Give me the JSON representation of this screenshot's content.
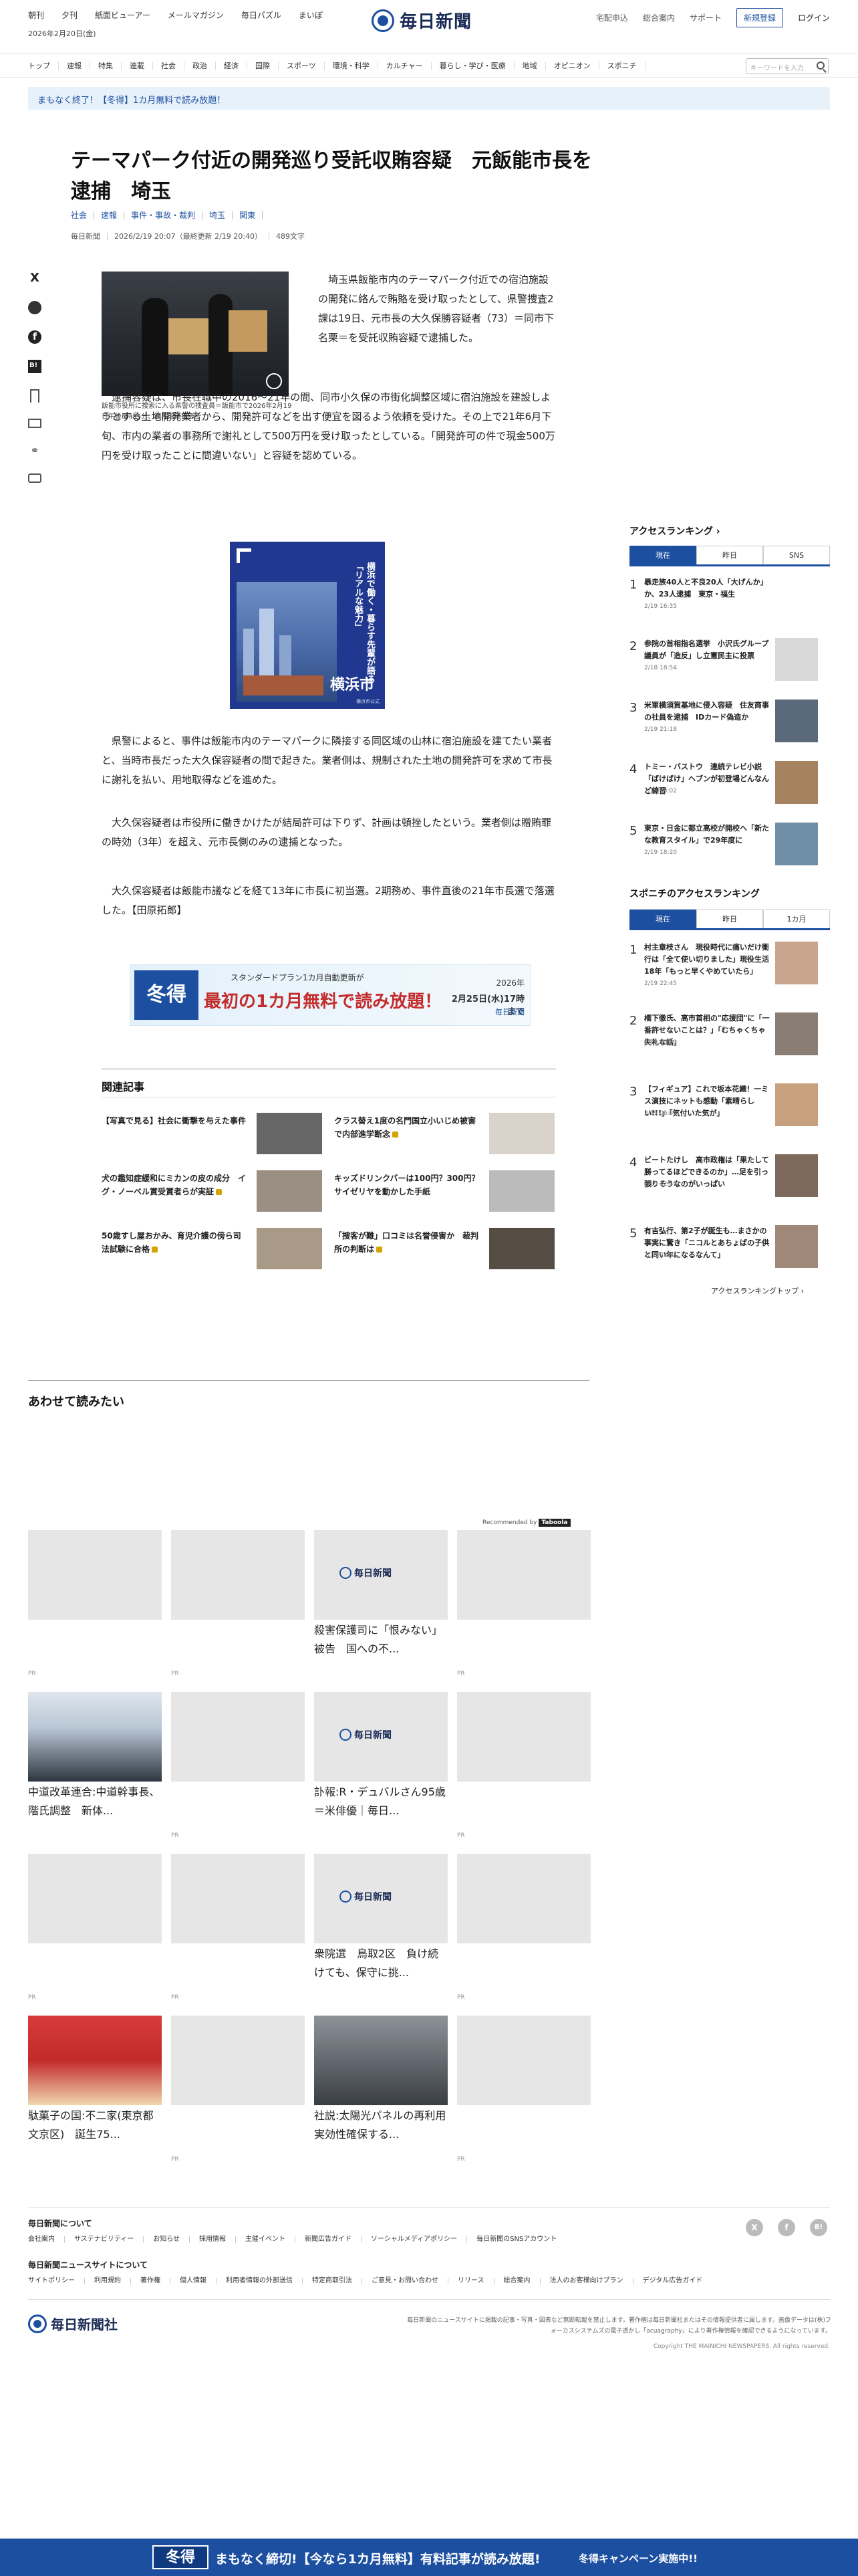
{
  "header": {
    "util_links": [
      "朝刊",
      "夕刊",
      "紙面ビューアー",
      "メールマガジン",
      "毎日パズル",
      "まいぽ"
    ],
    "date": "2026年2月20日(金)",
    "logo_text": "毎日新聞",
    "right_links": [
      "宅配申込",
      "総合案内",
      "サポート"
    ],
    "register_label": "新規登録",
    "login_label": "ログイン"
  },
  "nav": {
    "items": [
      "トップ",
      "速報",
      "特集",
      "連載",
      "社会",
      "政治",
      "経済",
      "国際",
      "スポーツ",
      "環境・科学",
      "カルチャー",
      "暮らし・学び・医療",
      "地域",
      "オピニオン",
      "スポニチ"
    ],
    "search_placeholder": "キーワードを入力"
  },
  "promo": {
    "text": "まもなく終了！【冬得】1カ月無料で読み放題！"
  },
  "article": {
    "title": "テーマパーク付近の開発巡り受託収賄容疑　元飯能市長を逮捕　埼玉",
    "tags": [
      "社会",
      "速報",
      "事件・事故・裁判",
      "埼玉",
      "関東"
    ],
    "meta": [
      "毎日新聞",
      "2026/2/19 20:07（最終更新 2/19 20:40）",
      "489文字"
    ],
    "photo_caption": "飯能市役所に捜索に入る県警の捜査員＝飯能市で2026年2月19日午後6時55分、高木昭午撮影",
    "p1": "埼玉県飯能市内のテーマパーク付近での宿泊施設の開発に絡んで賄賂を受け取ったとして、県警捜査2課は19日、元市長の大久保勝容疑者（73）＝同市下名栗＝を受託収賄容疑で逮捕した。",
    "p2": "逮捕容疑は、市長在職中の2016〜21年の間、同市小久保の市街化調整区域に宿泊施設を建設しようとする土地開発業者から、開発許可などを出す便宜を図るよう依頼を受けた。その上で21年6月下旬、市内の業者の事務所で謝礼として500万円を受け取ったとしている。「開発許可の件で現金500万円を受け取ったことに間違いない」と容疑を認めている。",
    "p3": "県警によると、事件は飯能市内のテーマパークに隣接する同区域の山林に宿泊施設を建てたい業者と、当時市長だった大久保容疑者の間で起きた。業者側は、規制された土地の開発許可を求めて市長に謝礼を払い、用地取得などを進めた。",
    "p4": "大久保容疑者は市役所に働きかけたが結局許可は下りず、計画は頓挫したという。業者側は贈賄罪の時効（3年）を超え、元市長側のみの逮捕となった。",
    "p5": "大久保容疑者は飯能市議などを経て13年に市長に初当選。2期務め、事件直後の21年市長選で落選した。【田原拓郎】"
  },
  "ad_city": {
    "vertical_text": "横浜で働く・暮らす先輩が語る「リアルな魅力」",
    "city": "横浜市",
    "small": "横浜市公式"
  },
  "ad_winter": {
    "badge": "冬得",
    "line1": "スタンダードプラン1カ月自動更新が",
    "line2": "最初の1カ月無料で読み放題！",
    "deadline_label": "2026年",
    "deadline": "2月25日(水)17時まで",
    "brand": "毎日新聞"
  },
  "related": {
    "heading": "関連記事",
    "items": [
      {
        "title": "【写真で見る】社会に衝撃を与えた事件"
      },
      {
        "title": "クラス替え1度の名門国立小いじめ被害で内部進学断念"
      },
      {
        "title": "犬の鑑知症緩和にミカンの皮の成分　イグ・ノーベル賞受賞者らが実証"
      },
      {
        "title": "キッズドリンクバーは100円？300円？　サイゼリヤを動かした手紙"
      },
      {
        "title": "50歳すし屋おかみ、育児介護の傍ら司法試験に合格"
      },
      {
        "title": "「捜客が難」口コミは名誉侵害か　裁判所の判断は"
      }
    ]
  },
  "ranking": {
    "heading": "アクセスランキング",
    "tabs": [
      "現在",
      "昨日",
      "SNS"
    ],
    "items": [
      {
        "rank": "1",
        "title": "暴走族40人と不良20人「大げんか」か、23人逮捕　東京・福生",
        "date": "2/19 16:35"
      },
      {
        "rank": "2",
        "title": "参院の首相指名選挙　小沢氏グループ議員が「造反」し立憲民主に投票",
        "date": "2/18 18:54"
      },
      {
        "rank": "3",
        "title": "米軍横須賀基地に侵入容疑　住友商事の社員を逮捕　IDカード偽造か",
        "date": "2/19 21:18"
      },
      {
        "rank": "4",
        "title": "トミー・バストウ　連続テレビ小説「ばけばけ」ヘブンが初登場どんなんど練習",
        "date": "2/19 13:02"
      },
      {
        "rank": "5",
        "title": "東京・日金に都立高校が開校へ「新たな教育スタイル」で29年度に",
        "date": "2/19 18:20"
      }
    ]
  },
  "sponichi": {
    "heading": "スポニチのアクセスランキング",
    "tabs": [
      "現在",
      "昨日",
      "1カ月"
    ],
    "items": [
      {
        "rank": "1",
        "title": "村主章枝さん　現役時代に痛いだけ衝行は「全て使い切りました」現役生活18年「もっと早くやめていたら」",
        "date": "2/19 22:45"
      },
      {
        "rank": "2",
        "title": "橋下徹氏、高市首相の\"応援団\"に「一番許せないことは？」「むちゃくちゃ失礼な話」",
        "date": "2/19 20:30"
      },
      {
        "rank": "3",
        "title": "【フィギュア】これで坂本花織！一ミス演技にネットも感動「素晴らしい!!!」「気付いた気が」",
        "date": "2/19 06:50"
      },
      {
        "rank": "4",
        "title": "ビートたけし　高市政権は「果たして勝ってるほどできるのか」…足を引っ張りそうなのがいっぱい",
        "date": "2/19 12:49"
      },
      {
        "rank": "5",
        "title": "有吉弘行、第2子が誕生も…まさかの事実に驚き「ニコルとあちょばの子供と同い年になるなんて」",
        "date": "2/15 22:52"
      }
    ],
    "more": "アクセスランキングトップ"
  },
  "readmore": {
    "heading": "あわせて読みたい",
    "recommended": "Recommended by",
    "taboola": "Taboola",
    "pr": "PR",
    "cards": [
      {
        "text": ""
      },
      {
        "text": ""
      },
      {
        "text": "殺害保護司に「恨みない」被告　国への不..."
      },
      {
        "text": ""
      },
      {
        "text": "中道改革連合:中道幹事長、階氏調整　新体..."
      },
      {
        "text": ""
      },
      {
        "text": "訃報:R・デュバルさん95歳＝米俳優｜毎日..."
      },
      {
        "text": ""
      },
      {
        "text": ""
      },
      {
        "text": ""
      },
      {
        "text": "衆院選　鳥取2区　負け続けても、保守に挑..."
      },
      {
        "text": ""
      },
      {
        "text": "駄菓子の国:不二家(東京都文京区)　誕生75..."
      },
      {
        "text": ""
      },
      {
        "text": "社説:太陽光パネルの再利用　実効性確保する..."
      },
      {
        "text": ""
      }
    ]
  },
  "footer": {
    "about_heading": "毎日新聞について",
    "about_links": [
      "会社案内",
      "サステナビリティー",
      "お知らせ",
      "採用情報",
      "主催イベント",
      "新聞広告ガイド",
      "ソーシャルメディアポリシー",
      "毎日新聞のSNSアカウント"
    ],
    "site_heading": "毎日新聞ニュースサイトについて",
    "site_links": [
      "サイトポリシー",
      "利用規約",
      "著作権",
      "個人情報",
      "利用者情報の外部送信",
      "特定商取引法",
      "ご意見・お問い合わせ",
      "リリース",
      "総合案内",
      "法人のお客様向けプラン",
      "デジタル広告ガイド"
    ],
    "sns": [
      "X",
      "f",
      "B!"
    ],
    "logo": "毎日新聞社",
    "note": "毎日新聞のニュースサイトに掲載の記事・写真・図表など無断転載を禁止します。著作権は毎日新聞社またはその情報提供者に属します。画像データは(株)フォーカスシステムズの電子透かし「acuagraphy」により著作権情報を確認できるようになっています。",
    "copyright": "Copyright THE MAINICHI NEWSPAPERS. All rights reserved."
  },
  "bottom_banner": {
    "badge": "冬得",
    "text": "まもなく締切!【今なら1カ月無料】有料記事が読み放題!",
    "cta": "冬得キャンペーン実施中!!"
  }
}
